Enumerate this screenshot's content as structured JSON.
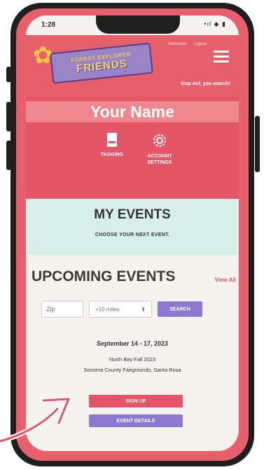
{
  "status": {
    "time": "1:28",
    "icons": "•ıl ◆ ▮"
  },
  "header": {
    "logo_top": "FOREST EXPLORER",
    "logo_main": "FRIENDS",
    "links": [
      "Welcome!",
      "Logout"
    ],
    "tagline": "Step out, you search!",
    "menu_icon": "hamburger-menu-icon"
  },
  "profile": {
    "name": "Your Name",
    "buttons": [
      {
        "label": "TAGGING",
        "icon": "tag-card-icon"
      },
      {
        "label": "ACCOUNT\nSETTINGS",
        "icon": "gear-icon"
      }
    ]
  },
  "my_events": {
    "title": "MY EVENTS",
    "subtitle": "CHOOSE YOUR NEXT EVENT."
  },
  "upcoming": {
    "title": "UPCOMING EVENTS",
    "view_all": "View All",
    "zip_placeholder": "Zip",
    "miles_value": "+10 miles",
    "search_label": "SEARCH",
    "event": {
      "date": "September 14 - 17, 2023",
      "name": "North Bay Fall 2023",
      "place": "Sonoma County Fairgrounds, Santa Rosa",
      "signup_label": "SIGN UP",
      "details_label": "EVENT DETAILS"
    }
  },
  "colors": {
    "brand_red": "#e45566",
    "brand_purple": "#8d7ad0",
    "mint": "#d9efec"
  }
}
